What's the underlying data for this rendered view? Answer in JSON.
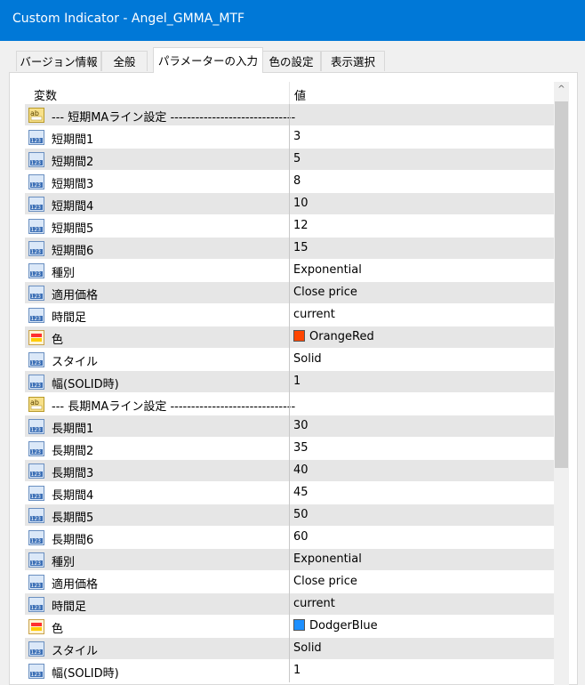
{
  "window": {
    "title": "Custom Indicator - Angel_GMMA_MTF"
  },
  "tabs": [
    {
      "label": "バージョン情報",
      "active": false
    },
    {
      "label": "全般",
      "active": false
    },
    {
      "label": "パラメーターの入力",
      "active": true
    },
    {
      "label": "色の設定",
      "active": false
    },
    {
      "label": "表示選択",
      "active": false
    }
  ],
  "grid": {
    "headers": {
      "name": "変数",
      "value": "値"
    },
    "rows": [
      {
        "icon": "text-icon",
        "name": "--- 短期MAライン設定 ------------------------------",
        "value": ""
      },
      {
        "icon": "number-icon",
        "name": "短期間1",
        "value": "3"
      },
      {
        "icon": "number-icon",
        "name": "短期間2",
        "value": "5"
      },
      {
        "icon": "number-icon",
        "name": "短期間3",
        "value": "8"
      },
      {
        "icon": "number-icon",
        "name": "短期間4",
        "value": "10"
      },
      {
        "icon": "number-icon",
        "name": "短期間5",
        "value": "12"
      },
      {
        "icon": "number-icon",
        "name": "短期間6",
        "value": "15"
      },
      {
        "icon": "number-icon",
        "name": "種別",
        "value": "Exponential"
      },
      {
        "icon": "number-icon",
        "name": "適用価格",
        "value": "Close price"
      },
      {
        "icon": "number-icon",
        "name": "時間足",
        "value": "current"
      },
      {
        "icon": "color-icon",
        "name": "色",
        "value": "OrangeRed",
        "swatch": "#ff4500"
      },
      {
        "icon": "number-icon",
        "name": "スタイル",
        "value": "Solid"
      },
      {
        "icon": "number-icon",
        "name": "幅(SOLID時)",
        "value": "1"
      },
      {
        "icon": "text-icon",
        "name": "--- 長期MAライン設定 ------------------------------",
        "value": ""
      },
      {
        "icon": "number-icon",
        "name": "長期間1",
        "value": "30"
      },
      {
        "icon": "number-icon",
        "name": "長期間2",
        "value": "35"
      },
      {
        "icon": "number-icon",
        "name": "長期間3",
        "value": "40"
      },
      {
        "icon": "number-icon",
        "name": "長期間4",
        "value": "45"
      },
      {
        "icon": "number-icon",
        "name": "長期間5",
        "value": "50"
      },
      {
        "icon": "number-icon",
        "name": "長期間6",
        "value": "60"
      },
      {
        "icon": "number-icon",
        "name": "種別",
        "value": "Exponential"
      },
      {
        "icon": "number-icon",
        "name": "適用価格",
        "value": "Close price"
      },
      {
        "icon": "number-icon",
        "name": "時間足",
        "value": "current"
      },
      {
        "icon": "color-icon",
        "name": "色",
        "value": "DodgerBlue",
        "swatch": "#1e90ff"
      },
      {
        "icon": "number-icon",
        "name": "スタイル",
        "value": "Solid"
      },
      {
        "icon": "number-icon",
        "name": "幅(SOLID時)",
        "value": "1"
      }
    ]
  },
  "scrollbar": {
    "up_glyph": "^"
  },
  "colors": {
    "titlebar": "#0078d7",
    "row_alt": "#e6e6e6"
  }
}
